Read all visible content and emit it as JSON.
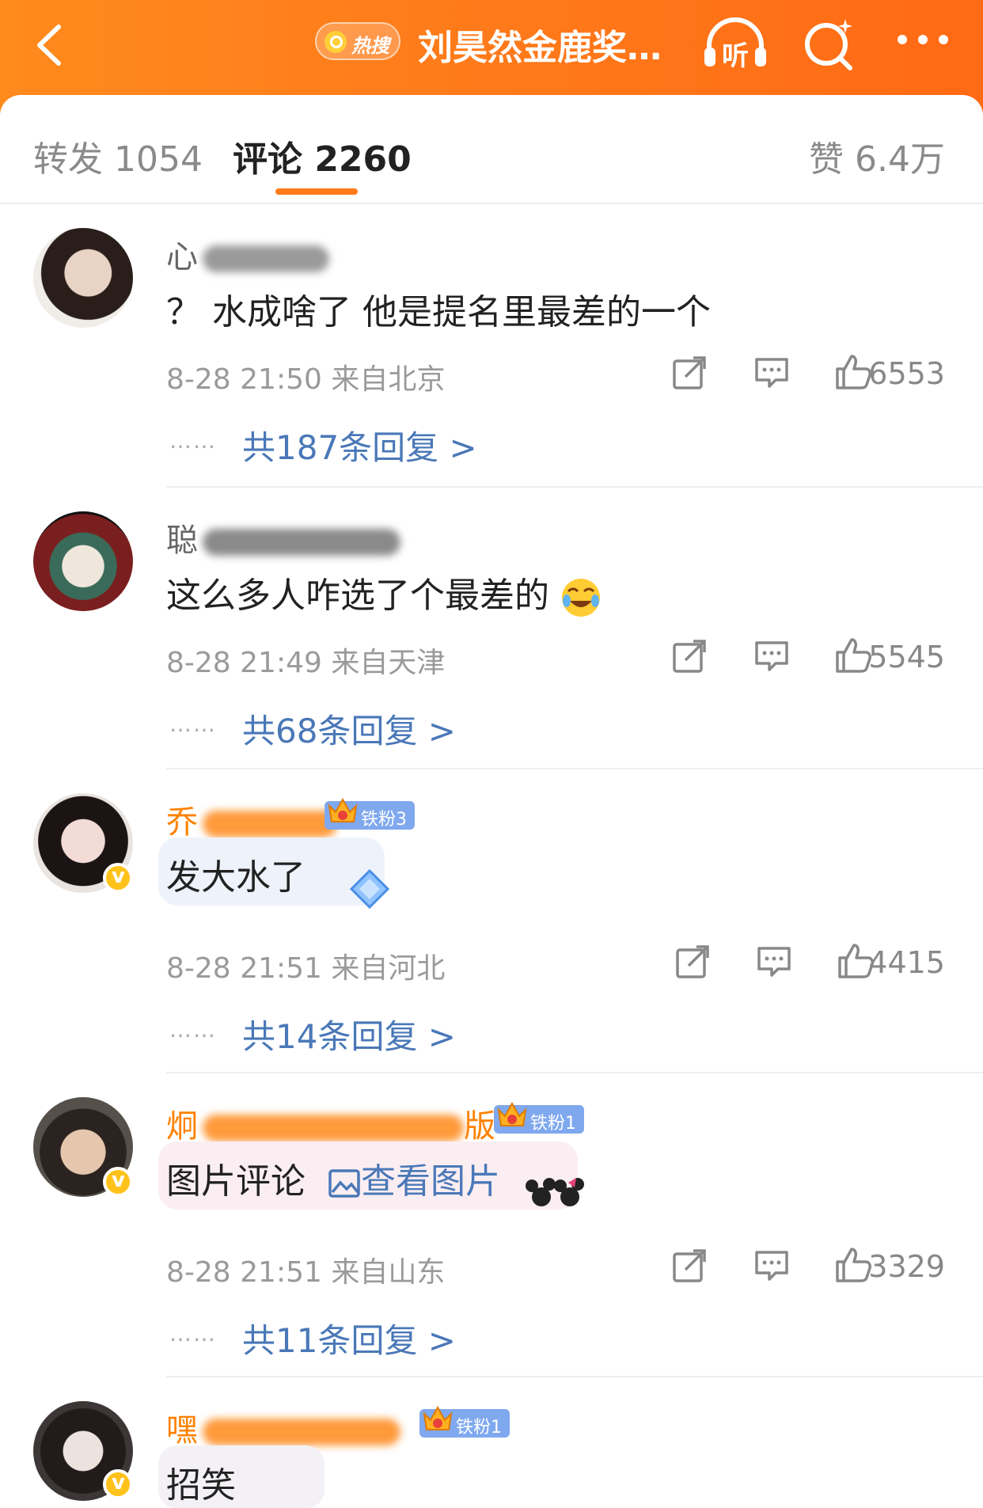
{
  "header": {
    "hot_label": "热搜",
    "title": "刘昊然金鹿奖…",
    "listen_label": "听"
  },
  "tabs": {
    "forward": "转发 1054",
    "comments": "评论 2260",
    "likes": "赞 6.4万"
  },
  "comments": [
    {
      "username_visible": "心",
      "text": "？ 水成啥了 他是提名里最差的一个",
      "meta": "8-28 21:50  来自北京",
      "likes": "6553",
      "replies": "共187条回复 >"
    },
    {
      "username_visible": "聪",
      "text": "这么多人咋选了个最差的",
      "meta": "8-28 21:49  来自天津",
      "likes": "5545",
      "replies": "共68条回复 >"
    },
    {
      "username_visible": "乔",
      "fan_badge": "铁粉3",
      "text": "发大水了",
      "meta": "8-28 21:51  来自河北",
      "likes": "4415",
      "replies": "共14条回复 >"
    },
    {
      "username_visible": "炯",
      "username_suffix": "版",
      "fan_badge": "铁粉1",
      "text": "图片评论",
      "image_link": "查看图片",
      "meta": "8-28 21:51  来自山东",
      "likes": "3329",
      "replies": "共11条回复 >"
    },
    {
      "username_visible": "嘿",
      "fan_badge": "铁粉1",
      "text": "招笑"
    }
  ],
  "colors": {
    "header_orange": "#ff7a1a",
    "link_blue": "#4a78b8",
    "username_orange": "#ff8200",
    "fan_badge_blue": "#7fa8ee"
  },
  "icons": [
    "back-icon",
    "search-icon",
    "listen-icon",
    "more-icon",
    "share-icon",
    "comment-icon",
    "like-icon",
    "image-icon",
    "crown-icon",
    "verified-icon"
  ]
}
